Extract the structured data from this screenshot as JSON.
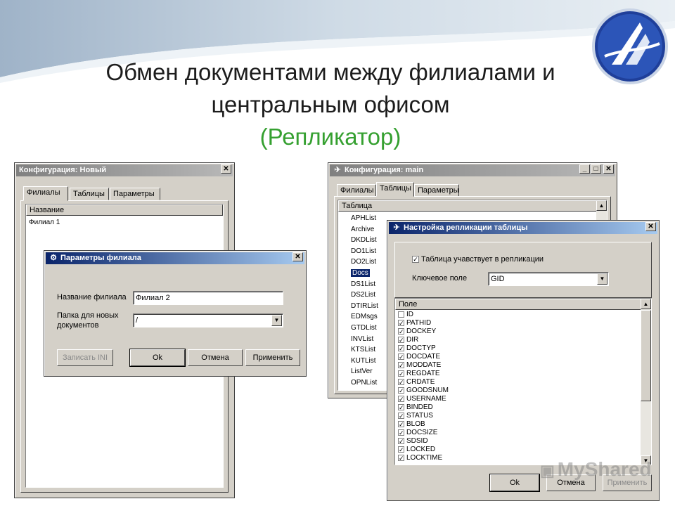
{
  "title": {
    "line1": "Обмен документами между филиалами и",
    "line2": "центральным офисом",
    "line3": "(Репликатор)"
  },
  "colors": {
    "accent_green": "#35a030",
    "titlebar_active": "#0a246a",
    "window_face": "#d4d0c8"
  },
  "win_config_new": {
    "title": "Конфигурация: Новый",
    "tabs": [
      "Филиалы",
      "Таблицы",
      "Параметры"
    ],
    "list_header": "Название",
    "items": [
      "Филиал 1"
    ]
  },
  "win_branch_params": {
    "title": "Параметры филиала",
    "name_label": "Название филиала",
    "name_value": "Филиал 2",
    "folder_label_1": "Папка для новых",
    "folder_label_2": "документов",
    "folder_value": "/",
    "buttons": {
      "write_ini": "Записать INI",
      "ok": "Ok",
      "cancel": "Отмена",
      "apply": "Применить"
    }
  },
  "win_config_main": {
    "title": "Конфигурация: main",
    "tabs": [
      "Филиалы",
      "Таблицы",
      "Параметры"
    ],
    "list_header": "Таблица",
    "tables": [
      "APHList",
      "Archive",
      "DKDList",
      "DO1List",
      "DO2List",
      "Docs",
      "DS1List",
      "DS2List",
      "DTIRList",
      "EDMsgs",
      "GTDList",
      "INVList",
      "KTSList",
      "KUTList",
      "ListVer",
      "OPNList"
    ],
    "selected_table": "Docs"
  },
  "win_replication": {
    "title": "Настройка репликации таблицы",
    "participates_label": "Таблица учавствует в репликации",
    "participates_checked": true,
    "key_field_label": "Ключевое поле",
    "key_field_value": "GID",
    "fields_header": "Поле",
    "fields": [
      {
        "name": "ID",
        "checked": false
      },
      {
        "name": "PATHID",
        "checked": true
      },
      {
        "name": "DOCKEY",
        "checked": true
      },
      {
        "name": "DIR",
        "checked": true
      },
      {
        "name": "DOCTYP",
        "checked": true
      },
      {
        "name": "DOCDATE",
        "checked": true
      },
      {
        "name": "MODDATE",
        "checked": true
      },
      {
        "name": "REGDATE",
        "checked": true
      },
      {
        "name": "CRDATE",
        "checked": true
      },
      {
        "name": "GOODSNUM",
        "checked": true
      },
      {
        "name": "USERNAME",
        "checked": true
      },
      {
        "name": "BINDED",
        "checked": true
      },
      {
        "name": "STATUS",
        "checked": true
      },
      {
        "name": "BLOB",
        "checked": true
      },
      {
        "name": "DOCSIZE",
        "checked": true
      },
      {
        "name": "SDSID",
        "checked": true
      },
      {
        "name": "LOCKED",
        "checked": true
      },
      {
        "name": "LOCKTIME",
        "checked": true
      }
    ],
    "buttons": {
      "ok": "Ok",
      "cancel": "Отмена",
      "apply": "Применить"
    }
  },
  "watermark": "MyShared"
}
